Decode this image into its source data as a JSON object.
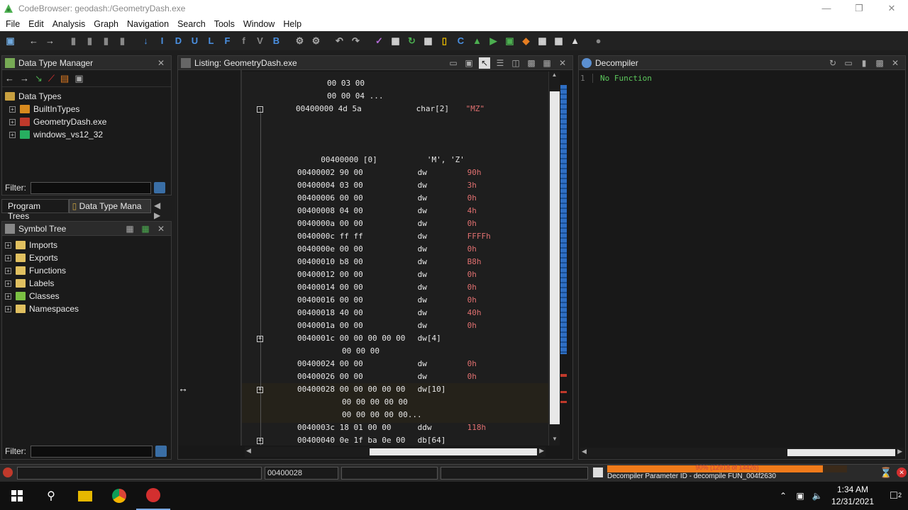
{
  "window": {
    "title": "CodeBrowser: geodash:/GeometryDash.exe"
  },
  "menu": [
    "File",
    "Edit",
    "Analysis",
    "Graph",
    "Navigation",
    "Search",
    "Tools",
    "Window",
    "Help"
  ],
  "toolbar": {
    "letters": [
      "I",
      "D",
      "U",
      "L",
      "F",
      "B"
    ]
  },
  "data_type_manager": {
    "title": "Data Type Manager",
    "root": "Data Types",
    "items": [
      "BuiltInTypes",
      "GeometryDash.exe",
      "windows_vs12_32"
    ],
    "filter_label": "Filter:"
  },
  "tabs": [
    "Program Trees",
    "Data Type Mana"
  ],
  "symbol_tree": {
    "title": "Symbol Tree",
    "items": [
      "Imports",
      "Exports",
      "Functions",
      "Labels",
      "Classes",
      "Namespaces"
    ],
    "filter_label": "Filter:"
  },
  "listing": {
    "title": "Listing:  GeometryDash.exe",
    "rows": [
      {
        "addr": "",
        "bytes": "00 03 00",
        "mnem": "",
        "oper": ""
      },
      {
        "addr": "",
        "bytes": "00 00 04 ...",
        "mnem": "",
        "oper": ""
      },
      {
        "addr": "00400000",
        "bytes": "4d 5a",
        "mnem": "char[2]",
        "oper": "\"MZ\""
      },
      {
        "addr": "",
        "bytes": "",
        "mnem": "",
        "oper": ""
      },
      {
        "addr": "",
        "bytes": "",
        "mnem": "",
        "oper": ""
      },
      {
        "addr": "  00400000",
        "bytes": "[0]",
        "mnem": "",
        "oper": "'M', 'Z'"
      },
      {
        "addr": "00400002",
        "bytes": "90 00",
        "mnem": "dw",
        "oper": "90h"
      },
      {
        "addr": "00400004",
        "bytes": "03 00",
        "mnem": "dw",
        "oper": "3h"
      },
      {
        "addr": "00400006",
        "bytes": "00 00",
        "mnem": "dw",
        "oper": "0h"
      },
      {
        "addr": "00400008",
        "bytes": "04 00",
        "mnem": "dw",
        "oper": "4h"
      },
      {
        "addr": "0040000a",
        "bytes": "00 00",
        "mnem": "dw",
        "oper": "0h"
      },
      {
        "addr": "0040000c",
        "bytes": "ff ff",
        "mnem": "dw",
        "oper": "FFFFh"
      },
      {
        "addr": "0040000e",
        "bytes": "00 00",
        "mnem": "dw",
        "oper": "0h"
      },
      {
        "addr": "00400010",
        "bytes": "b8 00",
        "mnem": "dw",
        "oper": "B8h"
      },
      {
        "addr": "00400012",
        "bytes": "00 00",
        "mnem": "dw",
        "oper": "0h"
      },
      {
        "addr": "00400014",
        "bytes": "00 00",
        "mnem": "dw",
        "oper": "0h"
      },
      {
        "addr": "00400016",
        "bytes": "00 00",
        "mnem": "dw",
        "oper": "0h"
      },
      {
        "addr": "00400018",
        "bytes": "40 00",
        "mnem": "dw",
        "oper": "40h"
      },
      {
        "addr": "0040001a",
        "bytes": "00 00",
        "mnem": "dw",
        "oper": "0h"
      },
      {
        "addr": "0040001c",
        "bytes": "00 00 00 00 00",
        "mnem": "dw[4]",
        "oper": ""
      },
      {
        "addr": "",
        "bytes": "00 00 00",
        "mnem": "",
        "oper": ""
      },
      {
        "addr": "00400024",
        "bytes": "00 00",
        "mnem": "dw",
        "oper": "0h"
      },
      {
        "addr": "00400026",
        "bytes": "00 00",
        "mnem": "dw",
        "oper": "0h"
      },
      {
        "addr": "00400028",
        "bytes": "00 00 00 00 00",
        "mnem": "dw[10]",
        "oper": ""
      },
      {
        "addr": "",
        "bytes": "00 00 00 00 00",
        "mnem": "",
        "oper": ""
      },
      {
        "addr": "",
        "bytes": "00 00 00 00 00...",
        "mnem": "",
        "oper": ""
      },
      {
        "addr": "0040003c",
        "bytes": "18 01 00 00",
        "mnem": "ddw",
        "oper": "118h"
      },
      {
        "addr": "00400040",
        "bytes": "0e 1f ba 0e 00",
        "mnem": "db[64]",
        "oper": ""
      }
    ]
  },
  "decompiler": {
    "title": "Decompiler",
    "line_no": "1",
    "text": "No Function"
  },
  "status": {
    "address": "00400028",
    "progress_text": "90% (12918 of 14426)",
    "progress": 0.9,
    "message": "Decompiler Parameter ID - decompile FUN_004f2630"
  },
  "clock": {
    "time": "1:34 AM",
    "date": "12/31/2021"
  },
  "notifications": "2"
}
